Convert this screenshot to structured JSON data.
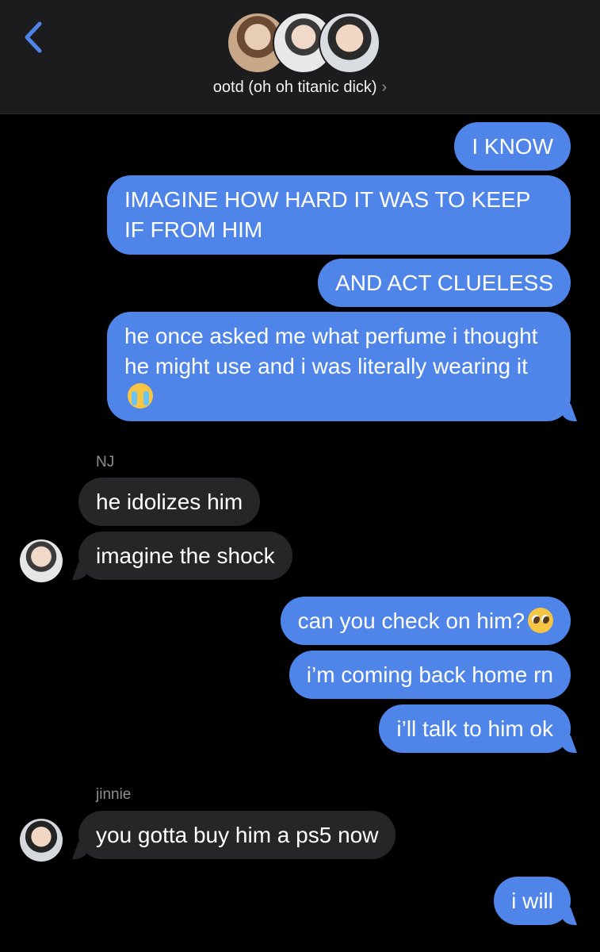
{
  "header": {
    "back_icon": "chevron-left-icon",
    "group_name": "ootd (oh oh titanic dick)",
    "chevron": "›",
    "accent": "#4f84e8"
  },
  "colors": {
    "outgoing": "#4f84e8",
    "incoming": "#262629",
    "background": "#000000"
  },
  "messages": [
    {
      "dir": "out",
      "text": "I KNOW"
    },
    {
      "dir": "out",
      "text": "IMAGINE HOW HARD IT WAS TO KEEP IF FROM HIM"
    },
    {
      "dir": "out",
      "text": "AND ACT CLUELESS"
    },
    {
      "dir": "out",
      "text": "he once asked me what perfume i thought he might use and i was literally wearing it",
      "emoji": "loudly-crying-face"
    },
    {
      "dir": "in",
      "sender": "NJ",
      "text": "he idolizes him"
    },
    {
      "dir": "in",
      "text": "imagine the shock"
    },
    {
      "dir": "out",
      "text": "can you check on him?",
      "emoji": "pleading-face"
    },
    {
      "dir": "out",
      "text": "i’m coming back home rn"
    },
    {
      "dir": "out",
      "text": "i’ll talk to him ok"
    },
    {
      "dir": "in",
      "sender": "jinnie",
      "text": "you gotta buy him a ps5 now"
    },
    {
      "dir": "out",
      "text": "i will"
    }
  ]
}
